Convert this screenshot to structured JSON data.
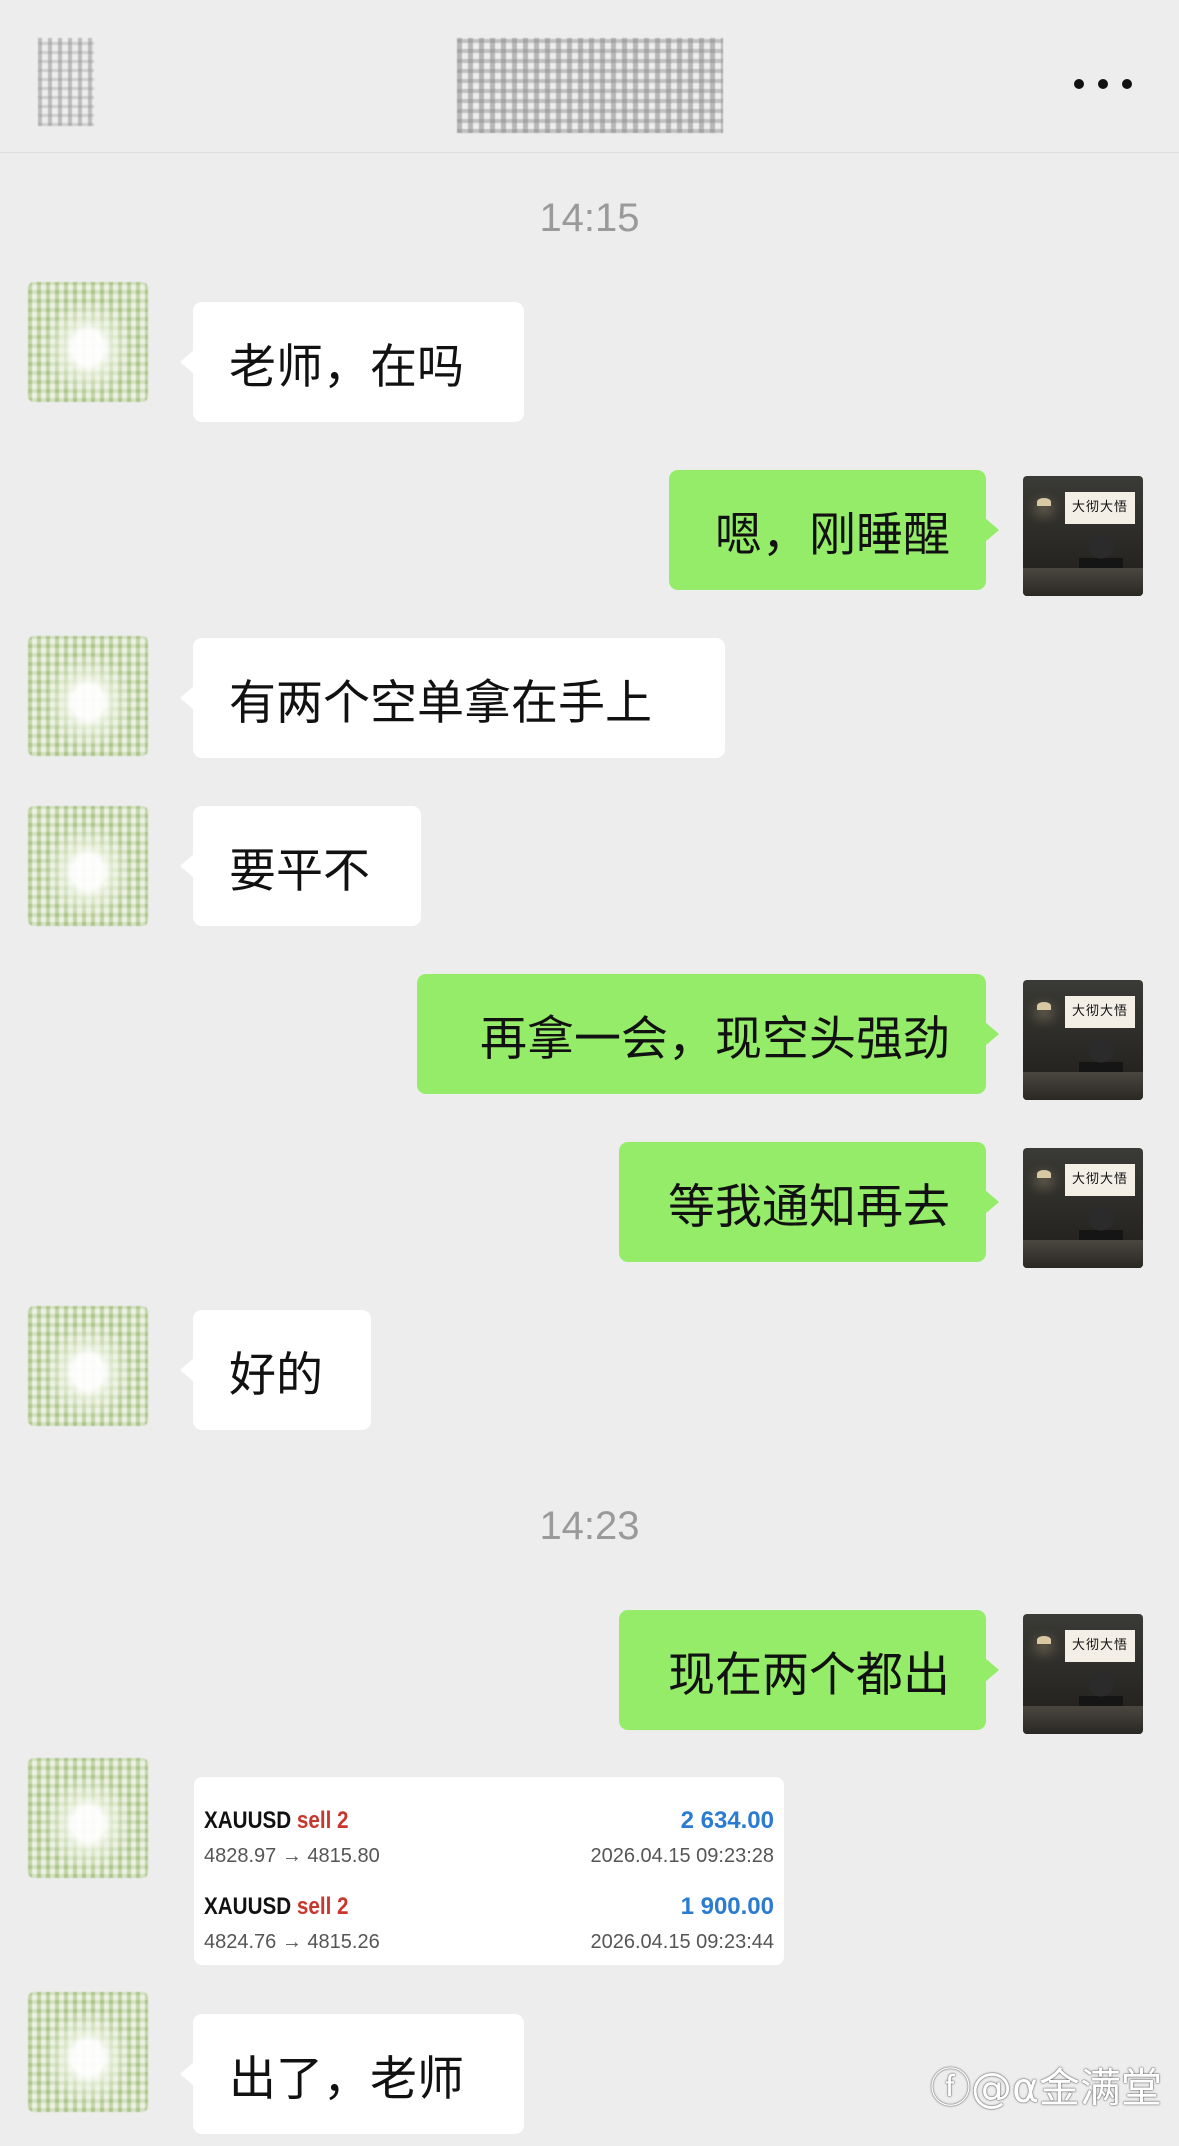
{
  "header": {
    "back_icon": "back-icon",
    "title": "",
    "more_icon": "more-icon"
  },
  "messages": [
    {
      "type": "time",
      "text": "14:15"
    },
    {
      "type": "in",
      "text": "老师，在吗"
    },
    {
      "type": "out",
      "text": "嗯，刚睡醒"
    },
    {
      "type": "in",
      "text": "有两个空单拿在手上"
    },
    {
      "type": "in",
      "text": "要平不"
    },
    {
      "type": "out",
      "text": "再拿一会，现空头强劲"
    },
    {
      "type": "out",
      "text": "等我通知再去"
    },
    {
      "type": "in",
      "text": "好的"
    },
    {
      "type": "time",
      "text": "14:23"
    },
    {
      "type": "out",
      "text": "现在两个都出"
    },
    {
      "type": "in",
      "text": "出了，老师"
    }
  ],
  "trade_card": {
    "rows": [
      {
        "symbol": "XAUUSD",
        "side": "sell 2",
        "profit": "2 634.00",
        "prices": "4828.97 → 4815.80",
        "time": "2026.04.15 09:23:28"
      },
      {
        "symbol": "XAUUSD",
        "side": "sell 2",
        "profit": "1 900.00",
        "prices": "4824.76 → 4815.26",
        "time": "2026.04.15 09:23:44"
      }
    ]
  },
  "my_avatar": {
    "sign_text": "大彻大悟"
  },
  "watermark": "ⓕ@α金满堂",
  "colors": {
    "background": "#ededed",
    "outgoing_bubble": "#95ec69",
    "incoming_bubble": "#ffffff",
    "sell_text": "#c8362d",
    "profit_text": "#2a7bd1",
    "timestamp": "#9a9a9a"
  }
}
